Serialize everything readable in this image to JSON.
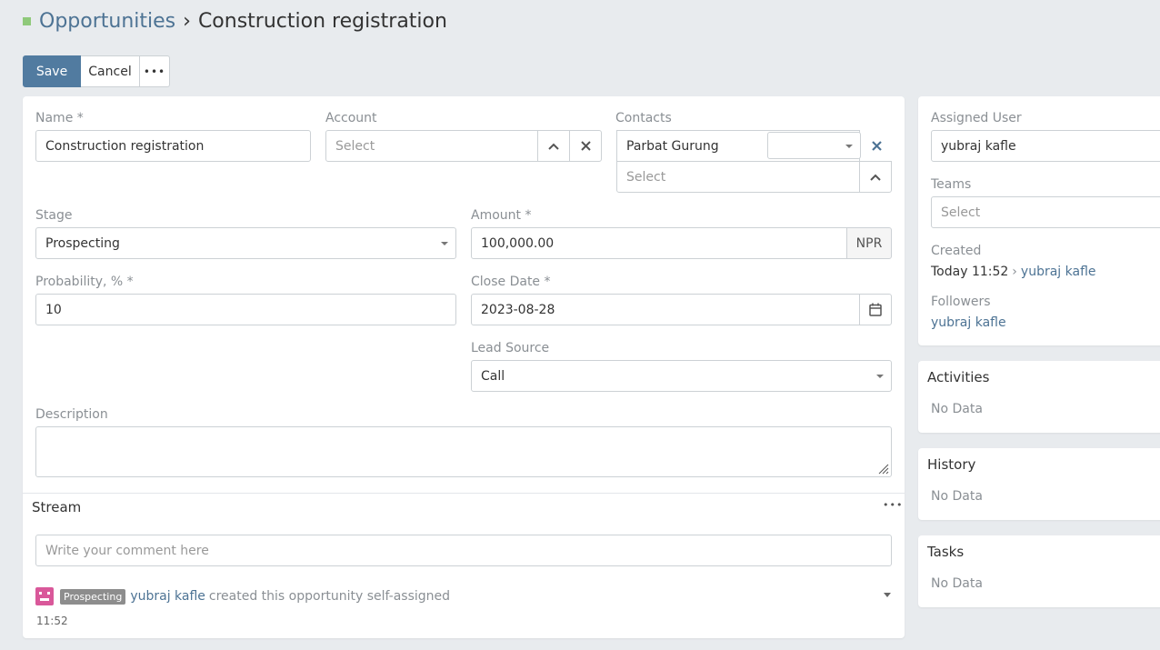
{
  "header": {
    "breadcrumb_link": "Opportunities",
    "separator": "›",
    "title": "Construction registration"
  },
  "toolbar": {
    "save_label": "Save",
    "cancel_label": "Cancel",
    "more_label": "•••"
  },
  "form": {
    "name_label": "Name *",
    "name_value": "Construction registration",
    "account_label": "Account",
    "account_placeholder": "Select",
    "contacts_label": "Contacts",
    "contact_name": "Parbat Gurung",
    "contact_role_value": "",
    "contacts_placeholder": "Select",
    "stage_label": "Stage",
    "stage_value": "Prospecting",
    "amount_label": "Amount *",
    "amount_value": "100,000.00",
    "currency": "NPR",
    "probability_label": "Probability, % *",
    "probability_value": "10",
    "close_date_label": "Close Date *",
    "close_date_value": "2023-08-28",
    "lead_source_label": "Lead Source",
    "lead_source_value": "Call",
    "description_label": "Description",
    "description_value": ""
  },
  "stream": {
    "title": "Stream",
    "more_label": "•••",
    "comment_placeholder": "Write your comment here",
    "note": {
      "badge": "Prospecting",
      "user": "yubraj kafle",
      "text": "created this opportunity self-assigned",
      "time": "11:52"
    }
  },
  "side": {
    "assigned_user_label": "Assigned User",
    "assigned_user_value": "yubraj kafle",
    "teams_label": "Teams",
    "teams_placeholder": "Select",
    "created_label": "Created",
    "created_time": "Today 11:52",
    "created_sep": "›",
    "created_user": "yubraj kafle",
    "followers_label": "Followers",
    "follower": "yubraj kafle"
  },
  "panels": {
    "activities_title": "Activities",
    "activities_empty": "No Data",
    "history_title": "History",
    "history_empty": "No Data",
    "tasks_title": "Tasks",
    "tasks_empty": "No Data"
  },
  "colors": {
    "primary": "#517ba0",
    "link": "#4d7394",
    "background": "#e8ebee",
    "avatar": "#d9589a",
    "badge": "#8d8d8d",
    "status_dot": "#8fc97a"
  },
  "icons": {
    "select_up": "chevron-up-icon",
    "clear": "close-icon",
    "calendar": "calendar-icon",
    "dropdown": "caret-down-icon",
    "resize": "resize-handle-icon"
  }
}
